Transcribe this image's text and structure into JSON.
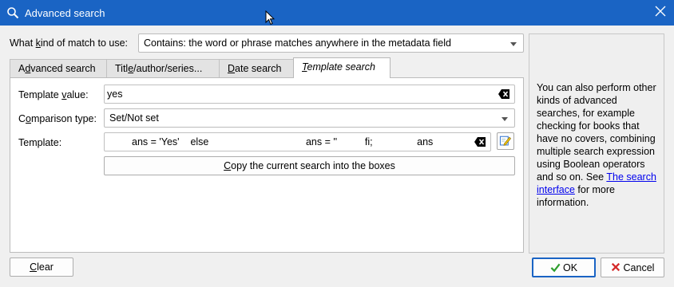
{
  "window": {
    "title": "Advanced search",
    "icon": "search-icon",
    "close_icon": "close-icon"
  },
  "match": {
    "label_pre": "What ",
    "label_key": "k",
    "label_post": "ind of match to use:",
    "value": "Contains: the word or phrase matches anywhere in the metadata field"
  },
  "tabs": [
    {
      "pre": "A",
      "key": "d",
      "post": "vanced search",
      "active": false
    },
    {
      "pre": "Titl",
      "key": "e",
      "post": "/author/series...",
      "active": false
    },
    {
      "pre": "",
      "key": "D",
      "post": "ate search",
      "active": false
    },
    {
      "pre": "",
      "key": "T",
      "post": "emplate search",
      "active": true
    }
  ],
  "template_tab": {
    "value_label_pre": "Template ",
    "value_label_key": "v",
    "value_label_post": "alue:",
    "value": "yes",
    "comparison_label_pre": "C",
    "comparison_label_key": "o",
    "comparison_label_post": "mparison type:",
    "comparison_value": "Set/Not set",
    "template_label": "Template:",
    "template_value": "ans = 'Yes'    else                                   ans = ''          fi;                ans",
    "copy_button_pre": "",
    "copy_button_key": "C",
    "copy_button_post": "opy the current search into the boxes"
  },
  "info": {
    "text": "You can also perform other kinds of advanced searches, for example checking for books that have no covers, combining multiple search expression using Boolean operators and so on. See",
    "link": "The search interface",
    "tail": " for more information."
  },
  "buttons": {
    "clear_key": "C",
    "clear_post": "lear",
    "ok": "OK",
    "cancel": "Cancel"
  },
  "colors": {
    "titlebar": "#1a64c4",
    "link": "#0000ee",
    "ok_check": "#2e9e2e",
    "cancel_x": "#d42a2a"
  }
}
